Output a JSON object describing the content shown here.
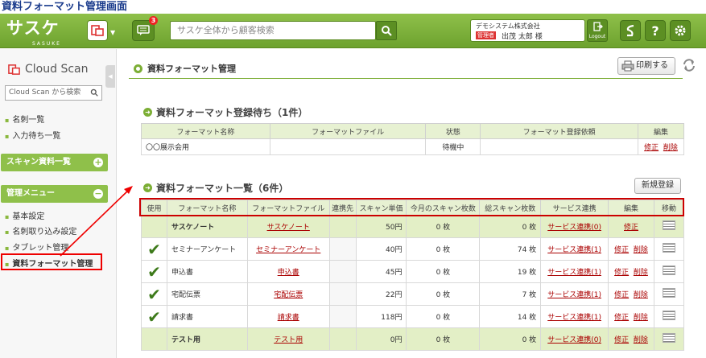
{
  "page_heading": "資料フォーマット管理画面",
  "topbar": {
    "logo": "サスケ",
    "logo_sub": "SASUKE",
    "notification_count": "3",
    "search_placeholder": "サスケ全体から顧客検索",
    "company": "デモシステム株式会社",
    "role": "管理者",
    "user": "出茂 太郎 様",
    "logout": "Logout",
    "help": "?"
  },
  "sidebar": {
    "title": "Cloud Scan",
    "search_placeholder": "Cloud Scan から検索",
    "links": [
      "名刺一覧",
      "入力待ち一覧"
    ],
    "sections": [
      "スキャン資料一覧",
      "管理メニュー"
    ],
    "admin_links": [
      "基本設定",
      "名刺取り込み設定",
      "タブレット管理",
      "資料フォーマット管理"
    ]
  },
  "main": {
    "title": "資料フォーマット管理",
    "print_label": "印刷する",
    "pending_title": "資料フォーマット登録待ち（1件）",
    "pending_headers": [
      "フォーマット名称",
      "フォーマットファイル",
      "状態",
      "フォーマット登録依頼",
      "編集"
    ],
    "pending_row": {
      "name": "〇〇展示会用",
      "file": "",
      "status": "待機中",
      "request": "",
      "edit": "修正",
      "delete": "削除"
    },
    "list_title": "資料フォーマット一覧（6件）",
    "new_button": "新規登録",
    "list_headers": [
      "使用",
      "フォーマット名称",
      "フォーマットファイル",
      "連携先",
      "スキャン単価",
      "今月のスキャン枚数",
      "総スキャン枚数",
      "サービス連携",
      "編集",
      "移動"
    ],
    "rows": [
      {
        "used": false,
        "name": "サスケノート",
        "file": "サスケノート",
        "price": "50円",
        "month": "0 枚",
        "total": "0 枚",
        "service": "サービス連携(0)",
        "edit": "修正",
        "delete": "",
        "highlight": true
      },
      {
        "used": true,
        "name": "セミナーアンケート",
        "file": "セミナーアンケート",
        "price": "40円",
        "month": "0 枚",
        "total": "74 枚",
        "service": "サービス連携(1)",
        "edit": "修正",
        "delete": "削除",
        "highlight": false
      },
      {
        "used": true,
        "name": "申込書",
        "file": "申込書",
        "price": "45円",
        "month": "0 枚",
        "total": "19 枚",
        "service": "サービス連携(1)",
        "edit": "修正",
        "delete": "削除",
        "highlight": false
      },
      {
        "used": true,
        "name": "宅配伝票",
        "file": "宅配伝票",
        "price": "22円",
        "month": "0 枚",
        "total": "7 枚",
        "service": "サービス連携(1)",
        "edit": "修正",
        "delete": "削除",
        "highlight": false
      },
      {
        "used": true,
        "name": "請求書",
        "file": "請求書",
        "price": "118円",
        "month": "0 枚",
        "total": "14 枚",
        "service": "サービス連携(1)",
        "edit": "修正",
        "delete": "削除",
        "highlight": false
      },
      {
        "used": false,
        "name": "テスト用",
        "file": "テスト用",
        "price": "0円",
        "month": "0 枚",
        "total": "0 枚",
        "service": "サービス連携(0)",
        "edit": "修正",
        "delete": "削除",
        "highlight": true
      }
    ]
  },
  "colors": {
    "accent": "#8fc04a",
    "highlight": "#e3efc6",
    "link": "#a00000",
    "annotation": "#e00000"
  }
}
